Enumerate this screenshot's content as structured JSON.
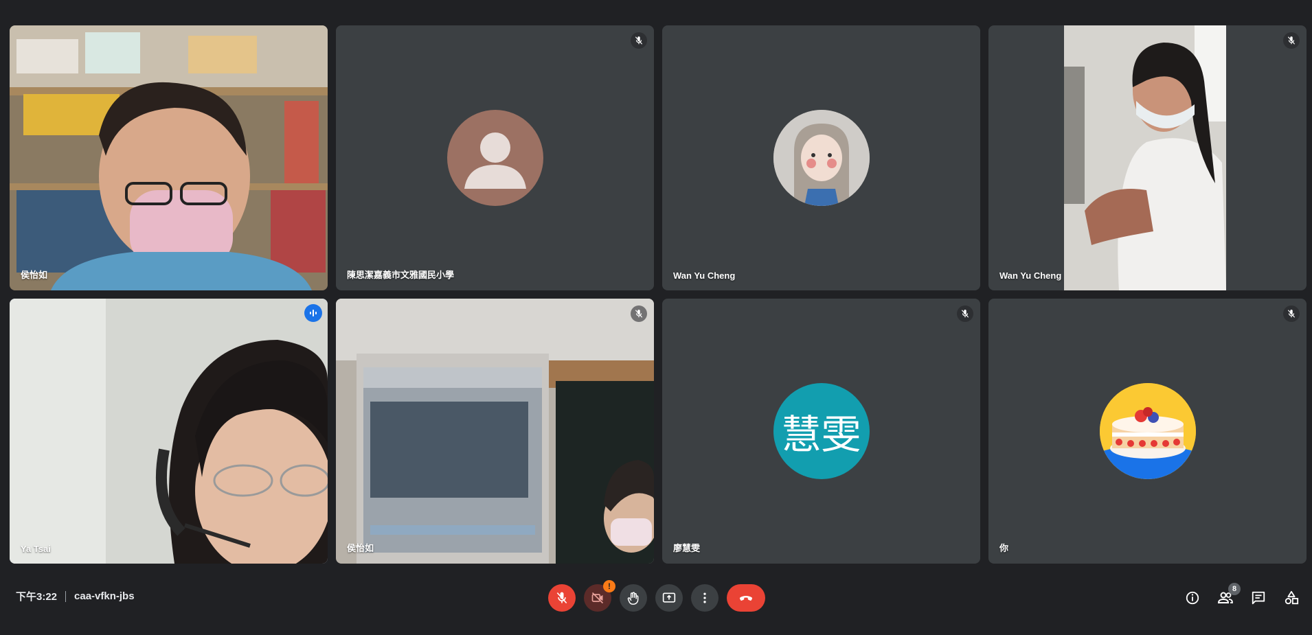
{
  "participants": [
    {
      "name": "侯怡如",
      "type": "video"
    },
    {
      "name": "陳思潔嘉義市文雅國民小學",
      "type": "avatar"
    },
    {
      "name": "Wan Yu Cheng",
      "type": "avatar"
    },
    {
      "name": "Wan Yu Cheng",
      "type": "video"
    },
    {
      "name": "Ya Tsai",
      "type": "video",
      "speaking": true
    },
    {
      "name": "侯怡如",
      "type": "video"
    },
    {
      "name": "廖慧雯",
      "type": "initials",
      "initials": "慧雯",
      "color": "#129eaf"
    },
    {
      "name": "你",
      "type": "avatar"
    }
  ],
  "meeting": {
    "time": "下午3:22",
    "code": "caa-vfkn-jbs"
  },
  "controls": {
    "mic": "mic-off-icon",
    "camera": "camera-off-icon",
    "camera_warning": "!",
    "hand": "raise-hand-icon",
    "present": "present-icon",
    "more": "more-vert-icon",
    "hangup": "hangup-icon"
  },
  "right_panel": {
    "people_count": "8"
  },
  "colors": {
    "background": "#202124",
    "tile": "#3c4043",
    "accent": "#8ab4f8",
    "danger": "#ea4335"
  }
}
